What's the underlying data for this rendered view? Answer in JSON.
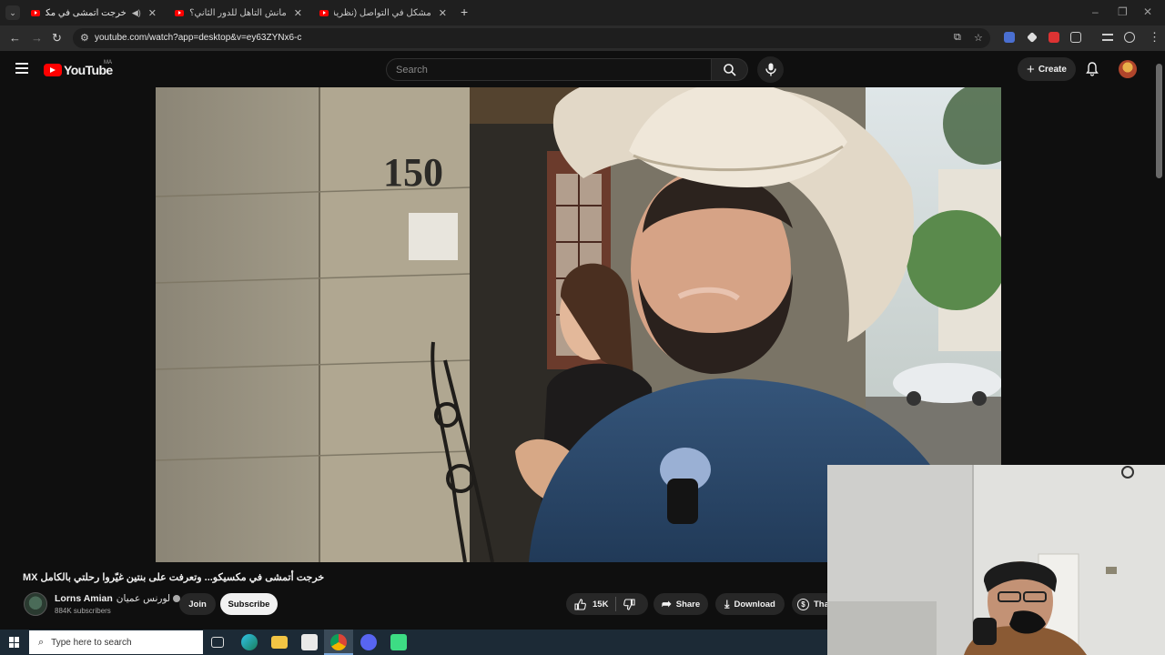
{
  "browser": {
    "tabs": [
      {
        "title": "خرجت أتمشى في مكسيكو...",
        "active": true,
        "audio": true
      },
      {
        "title": "مانش التأهل للدور الثاني؟ التشكـ",
        "active": false,
        "audio": false
      },
      {
        "title": "مشكل في التواصل (نظرية البرازا...",
        "active": false,
        "audio": false
      }
    ],
    "url": "youtube.com/watch?app=desktop&v=ey63ZYNx6-c"
  },
  "youtube": {
    "logo_text": "YouTube",
    "country_code": "MA",
    "search_placeholder": "Search",
    "create_label": "Create"
  },
  "video": {
    "title": "خرجت أتمشى في مكسيكو... وتعرفت على بنتين غيّروا رحلتي بالكامل MX",
    "building_number": "150",
    "channel": {
      "name": "Lorns Amian",
      "arabic_name": "لورنس عميان",
      "subscribers": "884K subscribers"
    },
    "actions": {
      "join": "Join",
      "subscribe": "Subscribe",
      "likes": "15K",
      "share": "Share",
      "download": "Download",
      "thanks": "Thanks"
    }
  },
  "taskbar": {
    "search_placeholder": "Type here to search"
  },
  "colors": {
    "brand_red": "#ff0000",
    "page_bg": "#0f0f0f",
    "pill_bg": "#272727"
  }
}
